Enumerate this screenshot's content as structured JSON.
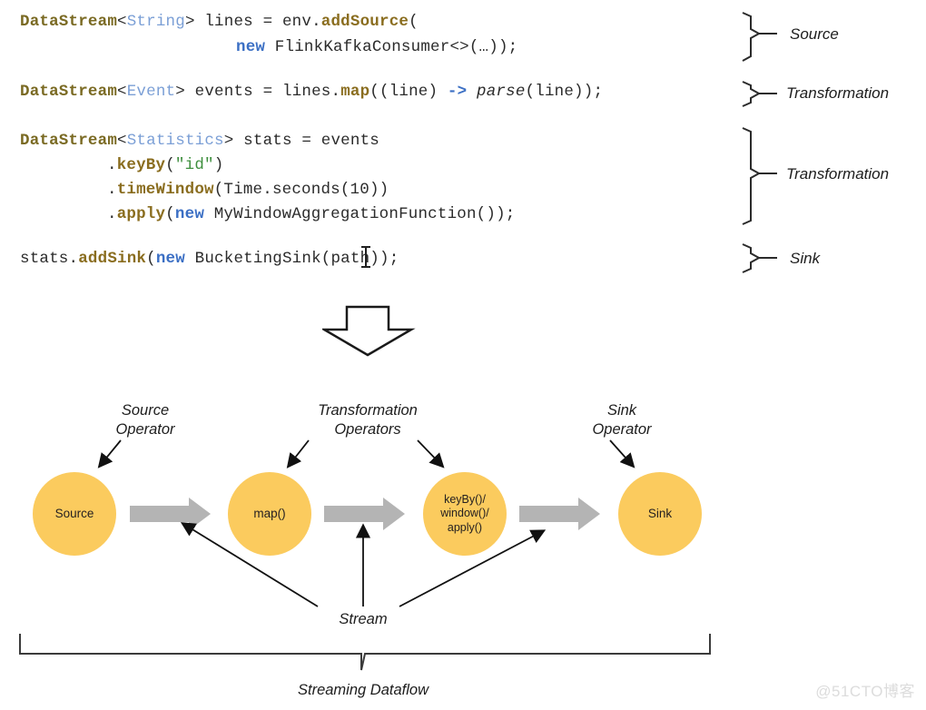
{
  "figure": {
    "kind": "flink-dataflow-diagram",
    "watermark": "@51CTO博客",
    "colors": {
      "node_fill": "#FBCB5E",
      "flow_arrow": "#B4B4B4",
      "type_token": "#7A6A23",
      "generic_token": "#7B9FD6",
      "method_token": "#8A6D1F",
      "keyword_token": "#3B6FC4",
      "string_token": "#3F8F3F",
      "line": "#2A2A2A",
      "watermark": "#DCDCDC"
    }
  },
  "code": {
    "lines": [
      {
        "id": "line-1",
        "indent": 0,
        "tokens": [
          {
            "t": "DataStream",
            "c": "tok-type"
          },
          {
            "t": "<",
            "c": "tok-plain"
          },
          {
            "t": "String",
            "c": "tok-generic"
          },
          {
            "t": "> lines = env.",
            "c": "tok-plain"
          },
          {
            "t": "addSource",
            "c": "tok-method"
          },
          {
            "t": "(",
            "c": "tok-plain"
          }
        ]
      },
      {
        "id": "line-2",
        "indent": 24,
        "tokens": [
          {
            "t": "new",
            "c": "tok-kw"
          },
          {
            "t": " FlinkKafkaConsumer<>(…));",
            "c": "tok-plain"
          }
        ]
      },
      {
        "id": "line-3",
        "indent": 0,
        "tokens": [
          {
            "t": "DataStream",
            "c": "tok-type"
          },
          {
            "t": "<",
            "c": "tok-plain"
          },
          {
            "t": "Event",
            "c": "tok-generic"
          },
          {
            "t": "> events = lines.",
            "c": "tok-plain"
          },
          {
            "t": "map",
            "c": "tok-method"
          },
          {
            "t": "((line) ",
            "c": "tok-plain"
          },
          {
            "t": "->",
            "c": "tok-kw"
          },
          {
            "t": " ",
            "c": "tok-plain"
          },
          {
            "t": "parse",
            "c": "tok-ital"
          },
          {
            "t": "(line));",
            "c": "tok-plain"
          }
        ]
      },
      {
        "id": "line-4",
        "indent": 0,
        "tokens": [
          {
            "t": "DataStream",
            "c": "tok-type"
          },
          {
            "t": "<",
            "c": "tok-plain"
          },
          {
            "t": "Statistics",
            "c": "tok-generic"
          },
          {
            "t": "> stats = events",
            "c": "tok-plain"
          }
        ]
      },
      {
        "id": "line-5",
        "indent": 8,
        "tokens": [
          {
            "t": ".",
            "c": "tok-plain"
          },
          {
            "t": "keyBy",
            "c": "tok-method"
          },
          {
            "t": "(",
            "c": "tok-plain"
          },
          {
            "t": "\"id\"",
            "c": "tok-str"
          },
          {
            "t": ")",
            "c": "tok-plain"
          }
        ]
      },
      {
        "id": "line-6",
        "indent": 8,
        "tokens": [
          {
            "t": ".",
            "c": "tok-plain"
          },
          {
            "t": "timeWindow",
            "c": "tok-method"
          },
          {
            "t": "(Time.seconds(10))",
            "c": "tok-plain"
          }
        ]
      },
      {
        "id": "line-7",
        "indent": 8,
        "tokens": [
          {
            "t": ".",
            "c": "tok-plain"
          },
          {
            "t": "apply",
            "c": "tok-method"
          },
          {
            "t": "(",
            "c": "tok-plain"
          },
          {
            "t": "new",
            "c": "tok-kw"
          },
          {
            "t": " MyWindowAggregationFunction());",
            "c": "tok-plain"
          }
        ]
      },
      {
        "id": "line-8",
        "indent": 0,
        "tokens": [
          {
            "t": "stats.",
            "c": "tok-plain"
          },
          {
            "t": "addSink",
            "c": "tok-method"
          },
          {
            "t": "(",
            "c": "tok-plain"
          },
          {
            "t": "new",
            "c": "tok-kw"
          },
          {
            "t": " BucketingSink(path));",
            "c": "tok-plain"
          }
        ]
      }
    ],
    "plain_text": [
      "DataStream<String> lines = env.addSource(",
      "                   new FlinkKafkaConsumer<>(…));",
      "DataStream<Event> events = lines.map((line) -> parse(line));",
      "DataStream<Statistics> stats = events",
      "        .keyBy(\"id\")",
      "        .timeWindow(Time.seconds(10))",
      "        .apply(new MyWindowAggregationFunction());",
      "stats.addSink(new BucketingSink(path));"
    ]
  },
  "brace_labels": [
    {
      "id": "brace-source",
      "label": "Source"
    },
    {
      "id": "brace-transformation-1",
      "label": "Transformation"
    },
    {
      "id": "brace-transformation-2",
      "label": "Transformation"
    },
    {
      "id": "brace-sink",
      "label": "Sink"
    }
  ],
  "flow": {
    "nodes": [
      {
        "id": "node-source",
        "label": "Source"
      },
      {
        "id": "node-map",
        "label": "map()"
      },
      {
        "id": "node-window",
        "label": "keyBy()/\nwindow()/\napply()"
      },
      {
        "id": "node-sink",
        "label": "Sink"
      }
    ],
    "annotations": [
      {
        "id": "annot-source-operator",
        "label": "Source\nOperator"
      },
      {
        "id": "annot-transform-operators",
        "label": "Transformation\nOperators"
      },
      {
        "id": "annot-sink-operator",
        "label": "Sink\nOperator"
      },
      {
        "id": "annot-stream",
        "label": "Stream"
      },
      {
        "id": "annot-streaming-dataflow",
        "label": "Streaming Dataflow"
      }
    ]
  }
}
